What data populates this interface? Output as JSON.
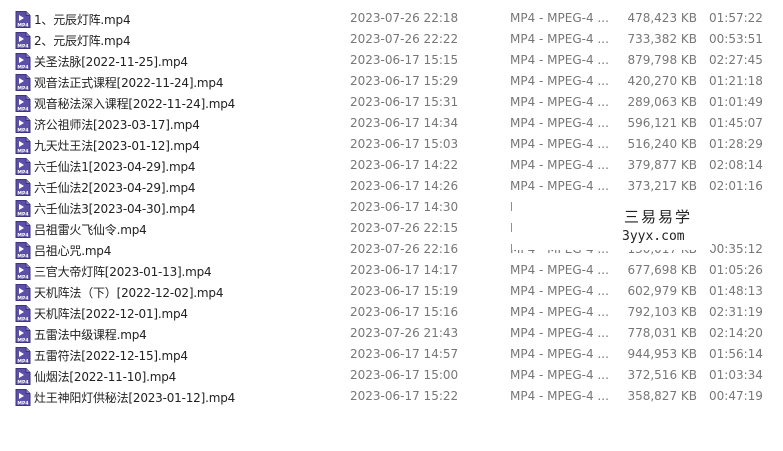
{
  "files": [
    {
      "name": "1、元辰灯阵.mp4",
      "date": "2023-07-26 22:18",
      "type": "MP4 - MPEG-4 ...",
      "size": "478,423 KB",
      "duration": "01:57:22"
    },
    {
      "name": "2、元辰灯阵.mp4",
      "date": "2023-07-26 22:22",
      "type": "MP4 - MPEG-4 ...",
      "size": "733,382 KB",
      "duration": "00:53:51"
    },
    {
      "name": "关圣法脉[2022-11-25].mp4",
      "date": "2023-06-17 15:15",
      "type": "MP4 - MPEG-4 ...",
      "size": "879,798 KB",
      "duration": "02:27:45"
    },
    {
      "name": "观音法正式课程[2022-11-24].mp4",
      "date": "2023-06-17 15:29",
      "type": "MP4 - MPEG-4 ...",
      "size": "420,270 KB",
      "duration": "01:21:18"
    },
    {
      "name": "观音秘法深入课程[2022-11-24].mp4",
      "date": "2023-06-17 15:31",
      "type": "MP4 - MPEG-4 ...",
      "size": "289,063 KB",
      "duration": "01:01:49"
    },
    {
      "name": "济公祖师法[2023-03-17].mp4",
      "date": "2023-06-17 14:34",
      "type": "MP4 - MPEG-4 ...",
      "size": "596,121 KB",
      "duration": "01:45:07"
    },
    {
      "name": "九天灶王法[2023-01-12].mp4",
      "date": "2023-06-17 15:03",
      "type": "MP4 - MPEG-4 ...",
      "size": "516,240 KB",
      "duration": "01:28:29"
    },
    {
      "name": "六壬仙法1[2023-04-29].mp4",
      "date": "2023-06-17 14:22",
      "type": "MP4 - MPEG-4 ...",
      "size": "379,877 KB",
      "duration": "02:08:14"
    },
    {
      "name": "六壬仙法2[2023-04-29].mp4",
      "date": "2023-06-17 14:26",
      "type": "MP4 - MPEG-4 ...",
      "size": "373,217 KB",
      "duration": "02:01:16"
    },
    {
      "name": "六壬仙法3[2023-04-30].mp4",
      "date": "2023-06-17 14:30",
      "type": "MP",
      "size": "",
      "duration": ""
    },
    {
      "name": "吕祖雷火飞仙令.mp4",
      "date": "2023-07-26 22:15",
      "type": "MP",
      "size": "",
      "duration": ""
    },
    {
      "name": "吕祖心咒.mp4",
      "date": "2023-07-26 22:16",
      "type": "MP4 - MPEG-4 ...",
      "size": "130,017 KB",
      "duration": "00:35:12"
    },
    {
      "name": "三官大帝灯阵[2023-01-13].mp4",
      "date": "2023-06-17 14:17",
      "type": "MP4 - MPEG-4 ...",
      "size": "677,698 KB",
      "duration": "01:05:26"
    },
    {
      "name": "天机阵法（下）[2022-12-02].mp4",
      "date": "2023-06-17 15:19",
      "type": "MP4 - MPEG-4 ...",
      "size": "602,979 KB",
      "duration": "01:48:13"
    },
    {
      "name": "天机阵法[2022-12-01].mp4",
      "date": "2023-06-17 15:16",
      "type": "MP4 - MPEG-4 ...",
      "size": "792,103 KB",
      "duration": "02:31:19"
    },
    {
      "name": "五雷法中级课程.mp4",
      "date": "2023-07-26 21:43",
      "type": "MP4 - MPEG-4 ...",
      "size": "778,031 KB",
      "duration": "02:14:20"
    },
    {
      "name": "五雷符法[2022-12-15].mp4",
      "date": "2023-06-17 14:57",
      "type": "MP4 - MPEG-4 ...",
      "size": "944,953 KB",
      "duration": "01:56:14"
    },
    {
      "name": "仙烟法[2022-11-10].mp4",
      "date": "2023-06-17 15:00",
      "type": "MP4 - MPEG-4 ...",
      "size": "372,516 KB",
      "duration": "01:03:34"
    },
    {
      "name": "灶王神阳灯供秘法[2023-01-12].mp4",
      "date": "2023-06-17 15:22",
      "type": "MP4 - MPEG-4 ...",
      "size": "358,827 KB",
      "duration": "00:47:19"
    }
  ],
  "watermark": {
    "line1": "三易易学",
    "line2": "3yyx.com"
  },
  "colors": {
    "icon_bg": "#5b4fa8",
    "icon_text": "#ffffff",
    "secondary_text": "#777777"
  },
  "icon": {
    "name": "video-file-icon",
    "label": "MP4"
  }
}
